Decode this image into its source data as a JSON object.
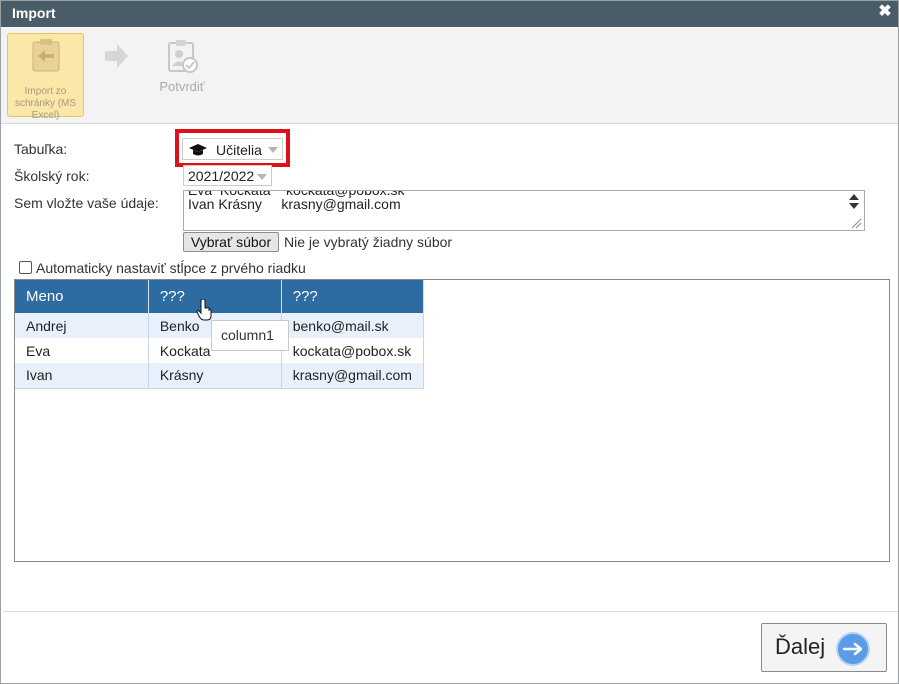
{
  "dialog": {
    "title": "Import"
  },
  "toolbar": {
    "import_label": "Import zo schránky (MS Excel)",
    "confirm_label": "Potvrdiť"
  },
  "form": {
    "table_label": "Tabuľka:",
    "table_value": "Učitelia",
    "year_label": "Školský rok:",
    "year_value": "2021/2022",
    "data_label": "Sem vložte vaše údaje:",
    "data_lines": [
      "Eva  Kockata    kockata@pobox.sk",
      "Ivan Krásny     krasny@gmail.com"
    ],
    "file_button": "Vybrať súbor",
    "file_status": "Nie je vybratý žiadny súbor",
    "auto_columns_label": "Automaticky nastaviť stĺpce z prvého riadku",
    "auto_columns_checked": false
  },
  "grid": {
    "columns": [
      "Meno",
      "???",
      "???"
    ],
    "rows": [
      [
        "Andrej",
        "Benko",
        "benko@mail.sk"
      ],
      [
        "Eva",
        "Kockata",
        "kockata@pobox.sk"
      ],
      [
        "Ivan",
        "Krásny",
        "krasny@gmail.com"
      ]
    ],
    "tooltip": "column1"
  },
  "footer": {
    "next_label": "Ďalej"
  },
  "colors": {
    "titlebar": "#4a5c68",
    "header": "#2c6ca3",
    "highlight": "#e0101a",
    "active_button": "#fbe7a8",
    "next_icon": "#5b9be8"
  }
}
